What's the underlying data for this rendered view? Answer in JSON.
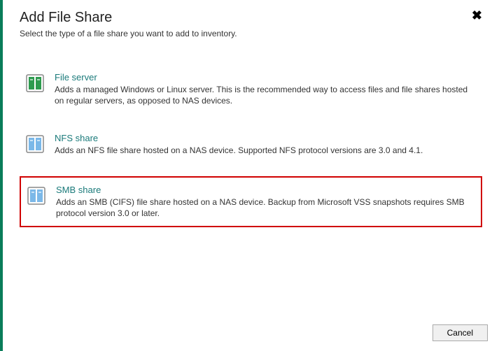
{
  "header": {
    "title": "Add File Share",
    "subtitle": "Select the type of a file share you want to add to inventory."
  },
  "options": [
    {
      "title": "File server",
      "description": "Adds a managed Windows or Linux server. This is the recommended way to access files and file shares hosted on regular servers, as opposed to NAS devices.",
      "icon_fill": "#2e9b4f",
      "highlighted": false
    },
    {
      "title": "NFS share",
      "description": "Adds an NFS file share hosted on a NAS device. Supported NFS protocol versions are 3.0 and 4.1.",
      "icon_fill": "#7bb8e8",
      "highlighted": false
    },
    {
      "title": "SMB share",
      "description": "Adds an SMB (CIFS) file share hosted on a NAS device. Backup from Microsoft VSS snapshots requires SMB protocol version 3.0 or later.",
      "icon_fill": "#7bb8e8",
      "highlighted": true
    }
  ],
  "footer": {
    "cancel_label": "Cancel"
  }
}
